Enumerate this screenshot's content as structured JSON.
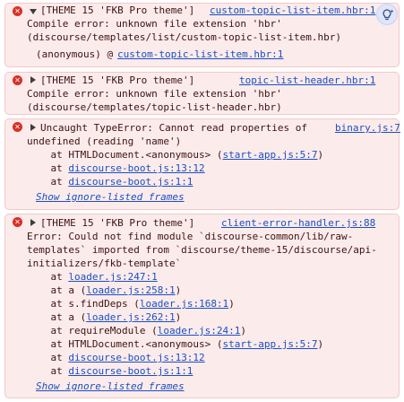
{
  "entries": [
    {
      "summary": "[THEME 15 'FKB Pro theme']",
      "source": "custom-topic-list-item.hbr:1",
      "lines": [
        "Compile error: unknown file extension 'hbr'",
        "(discourse/templates/list/custom-topic-list-item.hbr)"
      ],
      "anon_prefix": "(anonymous) @ ",
      "anon_link": "custom-topic-list-item.hbr:1"
    },
    {
      "summary": "[THEME 15 'FKB Pro theme']",
      "source": "topic-list-header.hbr:1",
      "lines": [
        "Compile error: unknown file extension 'hbr'",
        "(discourse/templates/topic-list-header.hbr)"
      ]
    },
    {
      "summary": "Uncaught TypeError: Cannot read properties of",
      "source": "binary.js:7",
      "lines": [
        "undefined (reading 'name')"
      ],
      "stack": [
        {
          "prefix": "    at HTMLDocument.<anonymous> (",
          "link": "start-app.js:5:7",
          "suffix": ")"
        },
        {
          "prefix": "    at ",
          "link": "discourse-boot.js:13:12",
          "suffix": ""
        },
        {
          "prefix": "    at ",
          "link": "discourse-boot.js:1:1",
          "suffix": ""
        }
      ],
      "ignore_label": "Show ignore-listed frames"
    },
    {
      "summary": "[THEME 15 'FKB Pro theme']",
      "source": "client-error-handler.js:88",
      "lines": [
        "Error: Could not find module `discourse-common/lib/raw-",
        "templates` imported from `discourse/theme-15/discourse/api-",
        "initializers/fkb-template`"
      ],
      "stack": [
        {
          "prefix": "    at ",
          "link": "loader.js:247:1",
          "suffix": ""
        },
        {
          "prefix": "    at a (",
          "link": "loader.js:258:1",
          "suffix": ")"
        },
        {
          "prefix": "    at s.findDeps (",
          "link": "loader.js:168:1",
          "suffix": ")"
        },
        {
          "prefix": "    at a (",
          "link": "loader.js:262:1",
          "suffix": ")"
        },
        {
          "prefix": "    at requireModule (",
          "link": "loader.js:24:1",
          "suffix": ")"
        },
        {
          "prefix": "    at HTMLDocument.<anonymous> (",
          "link": "start-app.js:5:7",
          "suffix": ")"
        },
        {
          "prefix": "    at ",
          "link": "discourse-boot.js:13:12",
          "suffix": ""
        },
        {
          "prefix": "    at ",
          "link": "discourse-boot.js:1:1",
          "suffix": ""
        }
      ],
      "ignore_label": "Show ignore-listed frames"
    }
  ],
  "icons": {
    "error": "error-icon",
    "expand_open": "triangle-down-icon",
    "expand_closed": "triangle-right-icon",
    "ai_insights": "ai-lightbulb-icon"
  },
  "colors": {
    "error_background": "#fcebeb",
    "error_border": "#f4c7c7",
    "error_icon": "#d93025",
    "link": "#1a4fc0"
  }
}
